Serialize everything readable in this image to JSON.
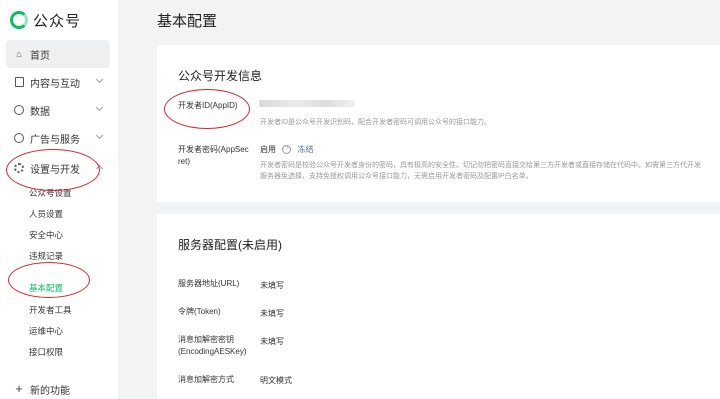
{
  "app": {
    "name": "公众号"
  },
  "sidebar": {
    "home": "首页",
    "content": "内容与互动",
    "data": "数据",
    "ads": "广告与服务",
    "settings": "设置与开发",
    "sub": [
      "公众号设置",
      "人员设置",
      "安全中心",
      "违规记录",
      "基本配置",
      "开发者工具",
      "运维中心",
      "接口权限"
    ],
    "new_feature": "新的功能"
  },
  "main": {
    "title": "基本配置",
    "dev_info": {
      "title": "公众号开发信息",
      "appid_label": "开发者ID(AppID)",
      "appid_hint": "开发者ID是公众号开发识别码，配合开发者密码可调用公众号的接口能力。",
      "secret_label_1": "开发者密码(AppSec",
      "secret_label_2": "ret)",
      "secret_status": "启用",
      "secret_action": "冻结",
      "secret_hint_1": "开发者密码是校验公众号开发者身份的密码，具有极高的安全性。切记勿把密码直接交给第三方开发者或直接存储在代码中。如需第三方代开发",
      "secret_hint_2": "服务器免选择，支持免授权调用公众号接口能力，无需启用开发者密码及配置IP白名单。"
    },
    "server": {
      "title": "服务器配置(未启用)",
      "url_label": "服务器地址(URL)",
      "url_value": "未填写",
      "token_label": "令牌(Token)",
      "token_value": "未填写",
      "aes_label_1": "消息加解密密钥",
      "aes_label_2": "(EncodingAESKey)",
      "aes_value": "未填写",
      "mode_label": "消息加解密方式",
      "mode_value": "明文模式"
    }
  },
  "colors": {
    "accent": "#07c160",
    "annotation": "#d9262c"
  }
}
